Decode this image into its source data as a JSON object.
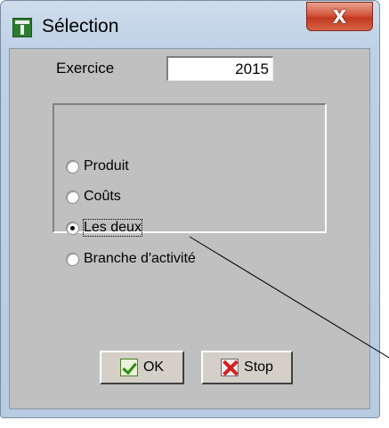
{
  "window": {
    "title": "Sélection",
    "close_symbol": "X"
  },
  "exercice": {
    "label": "Exercice",
    "value": "2015"
  },
  "options": [
    {
      "label": "Produit",
      "checked": false
    },
    {
      "label": "Coûts",
      "checked": false
    },
    {
      "label": "Les deux",
      "checked": true
    },
    {
      "label": "Branche d'activité",
      "checked": false
    }
  ],
  "buttons": {
    "ok_label": "OK",
    "stop_label": "Stop"
  },
  "icons": {
    "app": "app-icon",
    "close": "close-icon",
    "ok": "check-icon",
    "stop": "stop-icon"
  },
  "colors": {
    "dialog_background": "#c0c0c0",
    "close_button": "#c13a20",
    "titlebar": "#bcd0e6"
  }
}
